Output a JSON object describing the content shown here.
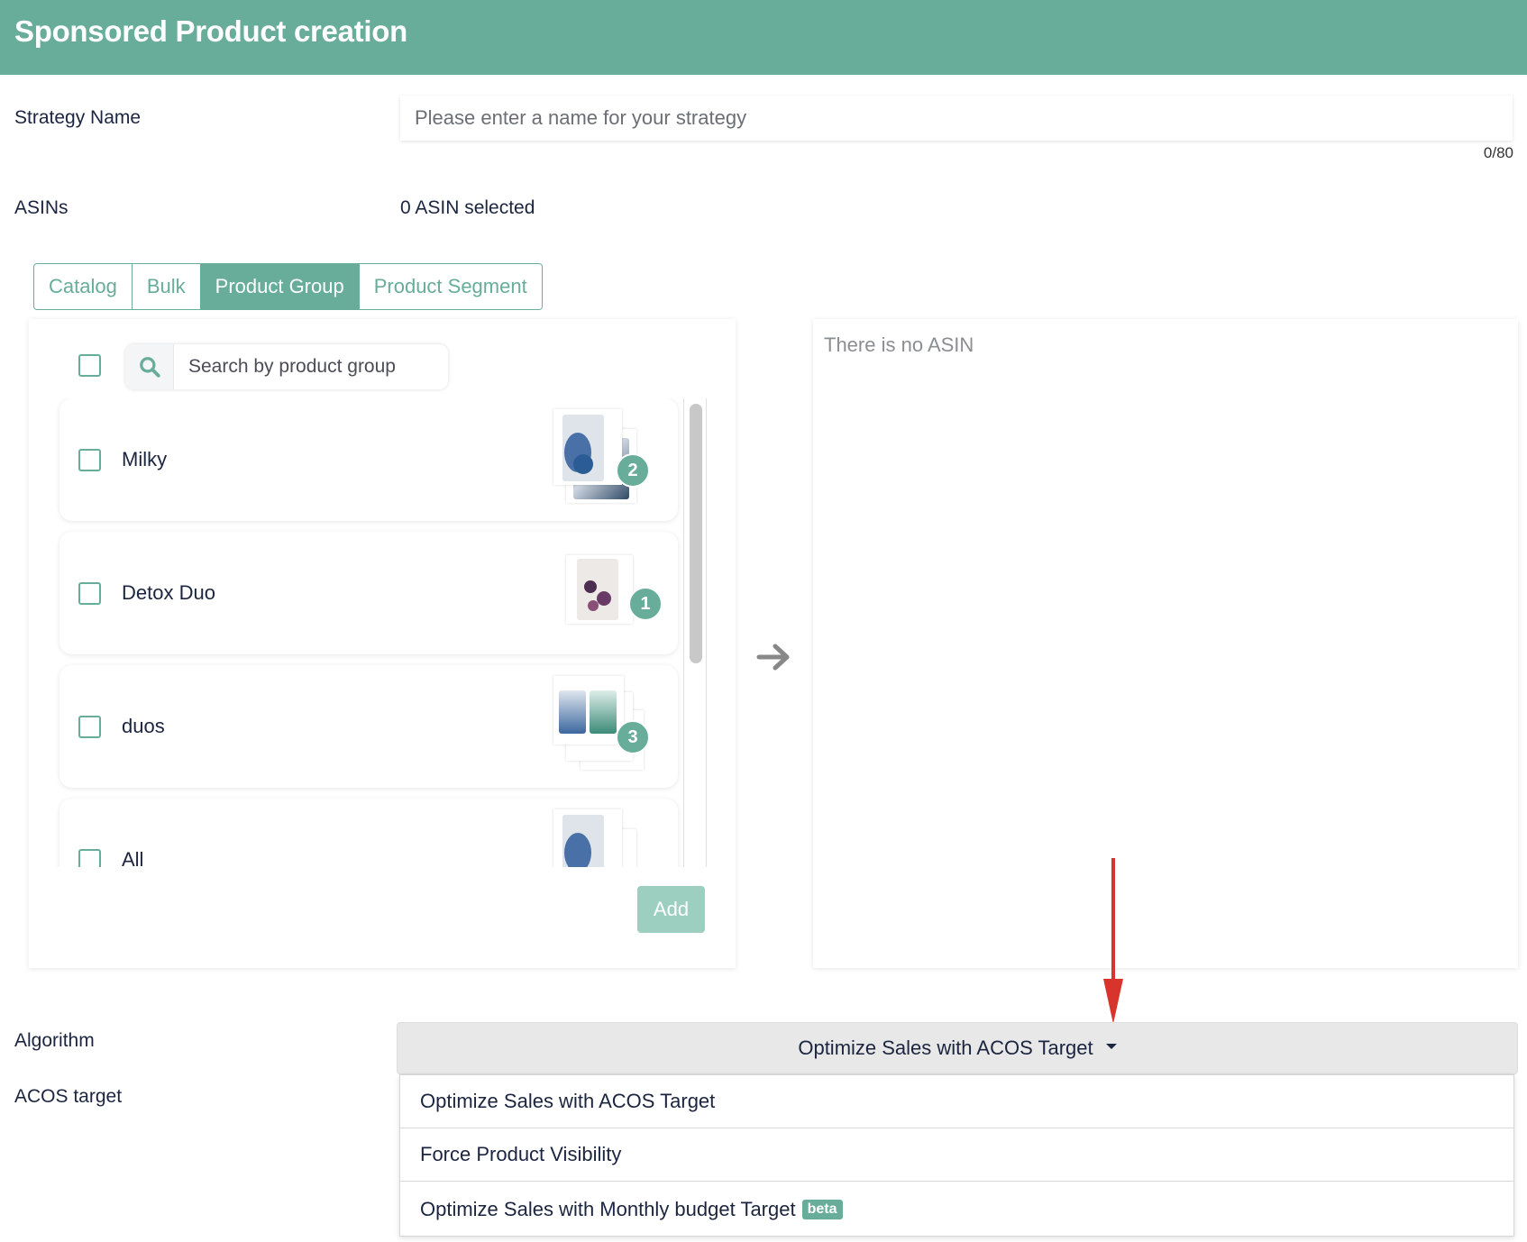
{
  "header": {
    "title": "Sponsored Product creation"
  },
  "strategy_name": {
    "label": "Strategy Name",
    "placeholder": "Please enter a name for your strategy",
    "value": "",
    "counter": "0/80"
  },
  "asins": {
    "label": "ASINs",
    "selected_text": "0 ASIN selected"
  },
  "tabs": [
    {
      "label": "Catalog",
      "active": false
    },
    {
      "label": "Bulk",
      "active": false
    },
    {
      "label": "Product Group",
      "active": true
    },
    {
      "label": "Product Segment",
      "active": false
    }
  ],
  "group_panel": {
    "search_placeholder": "Search by product group",
    "search_icon": "search-icon",
    "groups": [
      {
        "name": "Milky",
        "count": "2"
      },
      {
        "name": "Detox Duo",
        "count": "1"
      },
      {
        "name": "duos",
        "count": "3"
      },
      {
        "name": "All",
        "count": ""
      }
    ],
    "add_label": "Add"
  },
  "transfer_icon": "arrow-right-icon",
  "asin_panel": {
    "empty_text": "There is no ASIN"
  },
  "algorithm": {
    "label": "Algorithm",
    "selected": "Optimize Sales with ACOS Target",
    "options": [
      {
        "label": "Optimize Sales with ACOS Target",
        "badge": ""
      },
      {
        "label": "Force Product Visibility",
        "badge": ""
      },
      {
        "label": "Optimize Sales with Monthly budget Target",
        "badge": "beta"
      }
    ]
  },
  "acos_target": {
    "label": "ACOS target"
  },
  "colors": {
    "brand": "#67ad99",
    "brand_light": "#9ccfbf",
    "annotation_arrow": "#d9342b",
    "text": "#1c2540"
  }
}
